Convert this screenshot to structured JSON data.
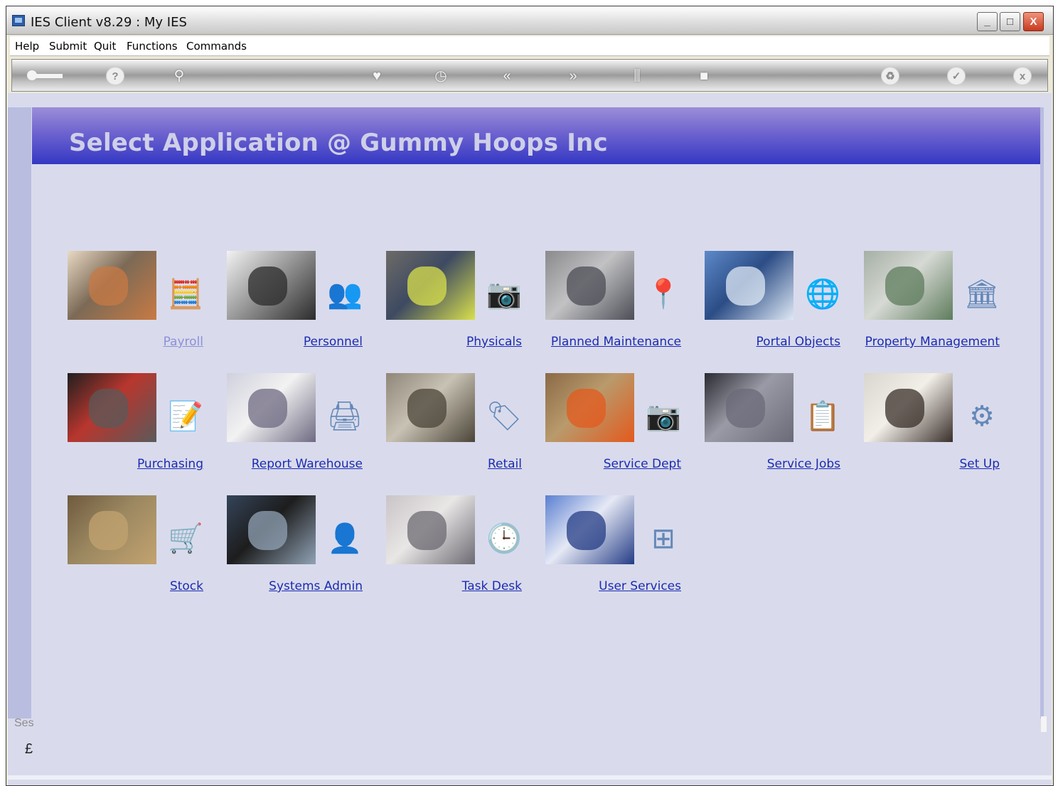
{
  "window": {
    "title": "IES Client v8.29 : My IES",
    "controls": {
      "minimize": "_",
      "maximize": "□",
      "close": "X"
    }
  },
  "menu": [
    "Help",
    "Submit",
    "Quit",
    "Functions",
    "Commands"
  ],
  "toolbar": {
    "buttons": [
      "key-icon",
      "help-icon",
      "search-icon",
      "heart-icon",
      "clock-icon",
      "back-icon",
      "forward-icon",
      "tree-icon",
      "stop-icon",
      "recycle-icon",
      "check-icon",
      "close-icon"
    ],
    "glyphs": {
      "help": "?",
      "search": "⚲",
      "heart": "♥",
      "clock": "◷",
      "back": "«",
      "forward": "»",
      "tree": "⫼",
      "stop": "■",
      "recycle": "♻",
      "check": "✓",
      "close": "x"
    }
  },
  "banner": {
    "title": "Select Application @  Gummy Hoops Inc"
  },
  "applications": [
    {
      "label": "Payroll",
      "icon": "payroll-icon",
      "glyph": "🧮",
      "photo": [
        "#e8d9c4",
        "#c87a44",
        "#7c6a56"
      ],
      "muted": true
    },
    {
      "label": "Personnel",
      "icon": "people-icon",
      "glyph": "👥",
      "photo": [
        "#f2f2f2",
        "#2b2b2b",
        "#9b9b9b"
      ]
    },
    {
      "label": "Physicals",
      "icon": "camera-icon",
      "glyph": "📷",
      "photo": [
        "#6d6b66",
        "#d9e04c",
        "#3e4a62"
      ]
    },
    {
      "label": "Planned Maintenance",
      "icon": "pin-icon",
      "glyph": "📍",
      "photo": [
        "#8a8a8c",
        "#4c4e56",
        "#c2c2c4"
      ]
    },
    {
      "label": "Portal Objects",
      "icon": "globe-icon",
      "glyph": "🌐",
      "photo": [
        "#5d89c9",
        "#dfe9f5",
        "#2c4d86"
      ]
    },
    {
      "label": "Property Management",
      "icon": "building-icon",
      "glyph": "🏛",
      "photo": [
        "#a6b0a5",
        "#5e7c5c",
        "#d6d9d4"
      ]
    },
    {
      "label": "Purchasing",
      "icon": "order-icon",
      "glyph": "📝",
      "photo": [
        "#1f1f1f",
        "#5a5a5a",
        "#b8362e"
      ]
    },
    {
      "label": "Report Warehouse",
      "icon": "printer-icon",
      "glyph": "🖨",
      "photo": [
        "#cfd0dd",
        "#6f6a82",
        "#f2f2f2"
      ]
    },
    {
      "label": "Retail",
      "icon": "sale-tag-icon",
      "glyph": "🏷",
      "photo": [
        "#8f8678",
        "#4b4438",
        "#c8c2b4"
      ]
    },
    {
      "label": "Service Dept",
      "icon": "camera-icon",
      "glyph": "📷",
      "photo": [
        "#8a6a46",
        "#e35a1d",
        "#b99a6c"
      ]
    },
    {
      "label": "Service Jobs",
      "icon": "clipboard-icon",
      "glyph": "📋",
      "photo": [
        "#2b2b33",
        "#6a6a78",
        "#9a9aa6"
      ]
    },
    {
      "label": "Set Up",
      "icon": "setup-icon",
      "glyph": "⚙",
      "photo": [
        "#d9d6cf",
        "#3a2f2a",
        "#f2efe8"
      ]
    },
    {
      "label": "Stock",
      "icon": "cart-icon",
      "glyph": "🛒",
      "photo": [
        "#6e5a3e",
        "#c3a370",
        "#9a8760"
      ]
    },
    {
      "label": "Systems Admin",
      "icon": "admin-icon",
      "glyph": "👤",
      "photo": [
        "#34445a",
        "#91a3b6",
        "#1d1d1d"
      ]
    },
    {
      "label": "Task Desk",
      "icon": "clock-icon",
      "glyph": "🕒",
      "photo": [
        "#c9c4c7",
        "#6c6a72",
        "#e9e6e6"
      ]
    },
    {
      "label": "User Services",
      "icon": "user-services-icon",
      "glyph": "⊞",
      "photo": [
        "#5a7fd1",
        "#243c86",
        "#e6e9f5"
      ]
    }
  ],
  "status": {
    "session_label": "Ses",
    "session_glyph": "£"
  },
  "colors": {
    "banner_top": "#9b8ed8",
    "banner_bottom": "#3438c4",
    "link": "#1c2bb0",
    "content_bg": "#d9dbec"
  }
}
